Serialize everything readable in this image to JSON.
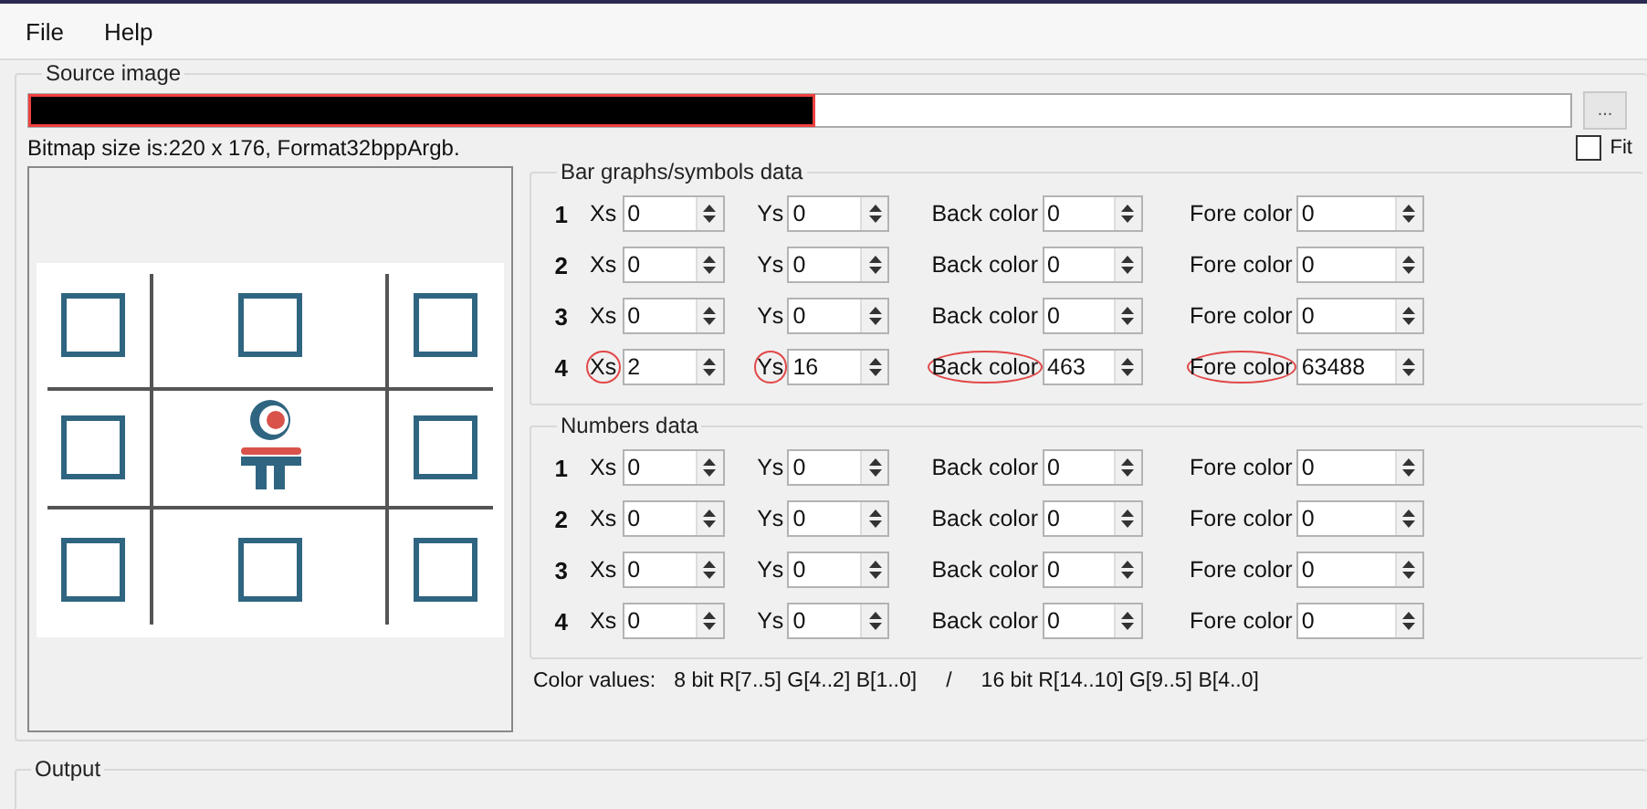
{
  "menu": [
    {
      "label": "File"
    },
    {
      "label": "Help"
    }
  ],
  "source_image": {
    "title": "Source image",
    "path_redacted": true,
    "browse_button": "...",
    "bitmap_info": "Bitmap size is:220 x 176, Format32bppArgb.",
    "fit": {
      "label": "Fit",
      "checked": false
    }
  },
  "bar_graphs": {
    "title": "Bar graphs/symbols data",
    "rows": [
      {
        "index": "1",
        "xs_label": "Xs",
        "xs": "0",
        "ys_label": "Ys",
        "ys": "0",
        "back_label": "Back color",
        "back": "0",
        "fore_label": "Fore color",
        "fore": "0",
        "highlighted": false
      },
      {
        "index": "2",
        "xs_label": "Xs",
        "xs": "0",
        "ys_label": "Ys",
        "ys": "0",
        "back_label": "Back color",
        "back": "0",
        "fore_label": "Fore color",
        "fore": "0",
        "highlighted": false
      },
      {
        "index": "3",
        "xs_label": "Xs",
        "xs": "0",
        "ys_label": "Ys",
        "ys": "0",
        "back_label": "Back color",
        "back": "0",
        "fore_label": "Fore color",
        "fore": "0",
        "highlighted": false
      },
      {
        "index": "4",
        "xs_label": "Xs",
        "xs": "2",
        "ys_label": "Ys",
        "ys": "16",
        "back_label": "Back color",
        "back": "463",
        "fore_label": "Fore color",
        "fore": "63488",
        "highlighted": true
      }
    ]
  },
  "numbers": {
    "title": "Numbers data",
    "rows": [
      {
        "index": "1",
        "xs_label": "Xs",
        "xs": "0",
        "ys_label": "Ys",
        "ys": "0",
        "back_label": "Back color",
        "back": "0",
        "fore_label": "Fore color",
        "fore": "0",
        "highlighted": false
      },
      {
        "index": "2",
        "xs_label": "Xs",
        "xs": "0",
        "ys_label": "Ys",
        "ys": "0",
        "back_label": "Back color",
        "back": "0",
        "fore_label": "Fore color",
        "fore": "0",
        "highlighted": false
      },
      {
        "index": "3",
        "xs_label": "Xs",
        "xs": "0",
        "ys_label": "Ys",
        "ys": "0",
        "back_label": "Back color",
        "back": "0",
        "fore_label": "Fore color",
        "fore": "0",
        "highlighted": false
      },
      {
        "index": "4",
        "xs_label": "Xs",
        "xs": "0",
        "ys_label": "Ys",
        "ys": "0",
        "back_label": "Back color",
        "back": "0",
        "fore_label": "Fore color",
        "fore": "0",
        "highlighted": false
      }
    ]
  },
  "color_values": {
    "label": "Color values:",
    "eight_bit": "8 bit R[7..5] G[4..2] B[1..0]",
    "separator": "/",
    "sixteen_bit": "16 bit R[14..10] G[9..5] B[4..0]"
  },
  "output": {
    "title": "Output"
  }
}
